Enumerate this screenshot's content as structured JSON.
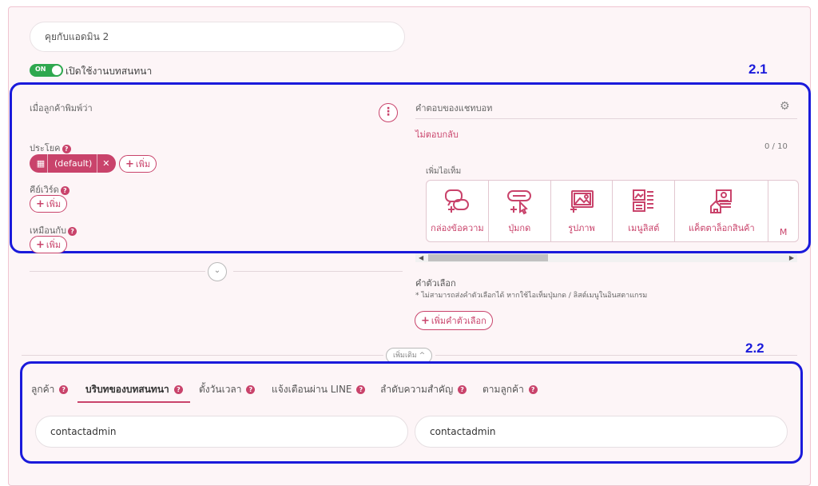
{
  "form": {
    "name_value": "คุยกับแอดมิน 2",
    "toggle_state": "ON",
    "toggle_label": "เปิดใช้งานบทสนทนา"
  },
  "left": {
    "heading": "เมื่อลูกค้าพิมพ์ว่า",
    "sentence_label": "ประโยค",
    "chip_label": "(default)",
    "add_label": "เพิ่ม",
    "keyword_label": "คีย์เวิร์ด",
    "similar_label": "เหมือนกับ"
  },
  "right": {
    "heading": "คำตอบของแชทบอท",
    "no_reply": "ไม่ตอบกลับ",
    "counter": "0 / 10",
    "add_item_label": "เพิ่มไอเท็ม",
    "tiles": [
      {
        "label": "กล่องข้อความ",
        "icon": "message-box-icon"
      },
      {
        "label": "ปุ่มกด",
        "icon": "button-icon"
      },
      {
        "label": "รูปภาพ",
        "icon": "image-icon"
      },
      {
        "label": "เมนูลิสต์",
        "icon": "menu-list-icon"
      },
      {
        "label": "แค็ตตาล็อกสินค้า",
        "icon": "product-catalog-icon"
      },
      {
        "label": "M",
        "icon": "more-icon"
      }
    ],
    "options_label": "คำตัวเลือก",
    "options_note": "* ไม่สามารถส่งคำตัวเลือกได้ หากใช้ไอเท็มปุ่มกด / ลิสต์เมนูในอินสตาแกรม",
    "add_option_label": "เพิ่มคำตัวเลือก"
  },
  "more_label": "เพิ่มเติม ^",
  "annotations": {
    "box1": "2.1",
    "box2": "2.2"
  },
  "tabs": [
    {
      "label": "ลูกค้า"
    },
    {
      "label": "บริบทของบทสนทนา"
    },
    {
      "label": "ตั้งวันเวลา"
    },
    {
      "label": "แจ้งเตือนผ่าน LINE"
    },
    {
      "label": "ลำดับความสำคัญ"
    },
    {
      "label": "ตามลูกค้า"
    }
  ],
  "context_values": [
    "contactadmin",
    "contactadmin"
  ],
  "colors": {
    "accent": "#c9436b",
    "highlight": "#1a1adb",
    "toggle_on": "#2fa84f"
  }
}
